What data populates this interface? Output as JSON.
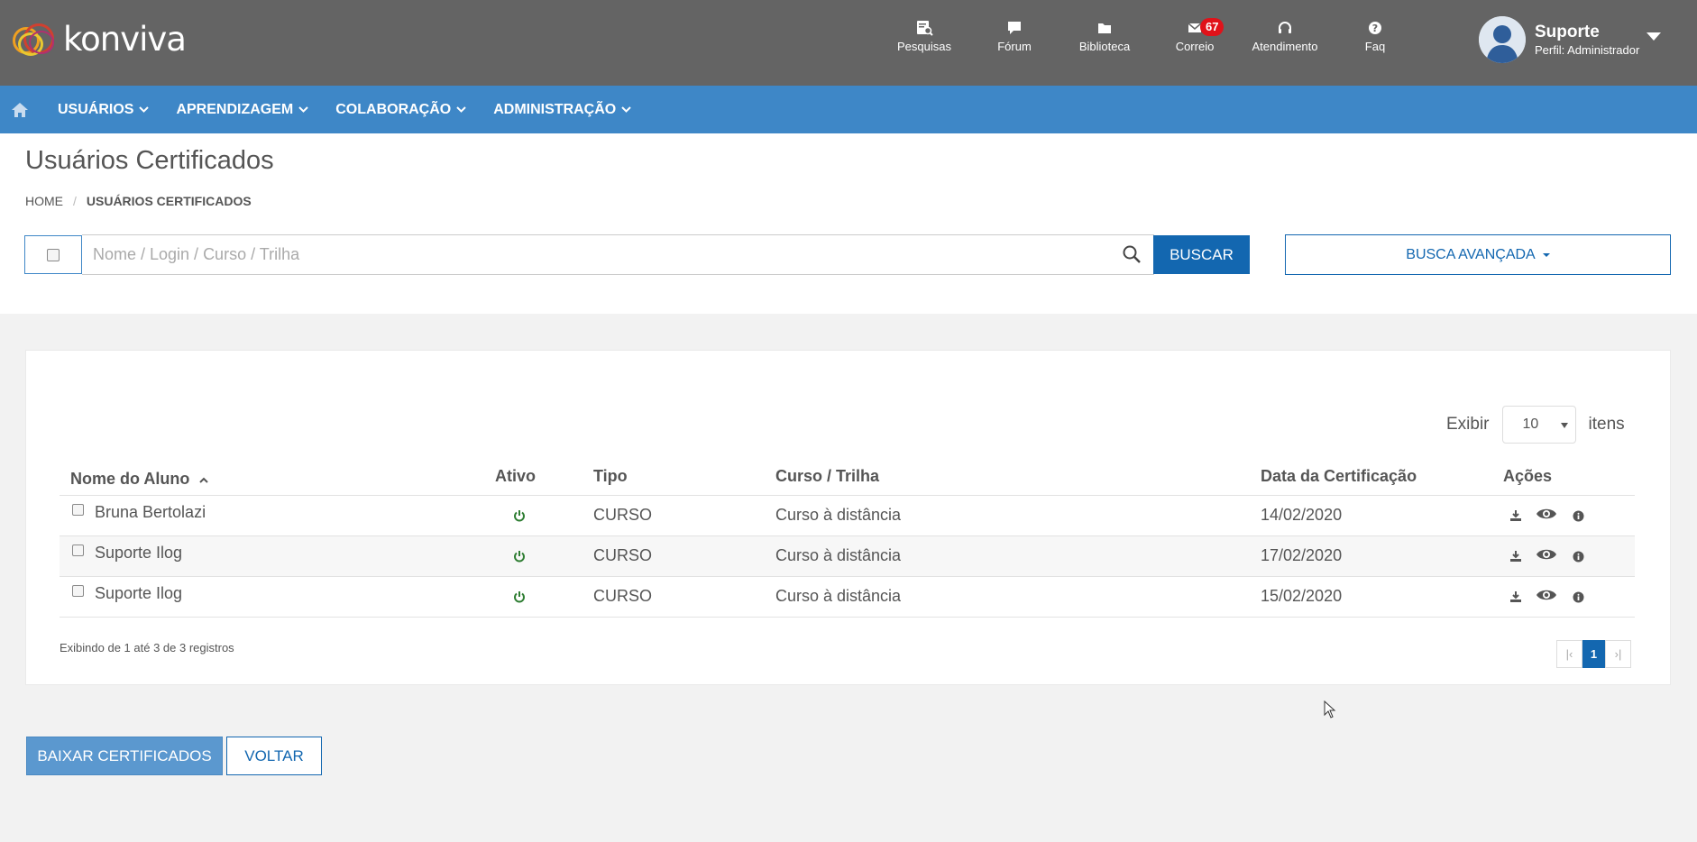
{
  "brand": {
    "name": "konviva"
  },
  "topnav": [
    {
      "label": "Pesquisas",
      "icon": "survey-icon"
    },
    {
      "label": "Fórum",
      "icon": "chat-bubble-icon"
    },
    {
      "label": "Biblioteca",
      "icon": "folder-icon"
    },
    {
      "label": "Correio",
      "icon": "envelope-icon",
      "badge": "67"
    },
    {
      "label": "Atendimento",
      "icon": "headset-icon"
    },
    {
      "label": "Faq",
      "icon": "question-icon"
    }
  ],
  "user": {
    "name": "Suporte",
    "role": "Perfil: Administrador"
  },
  "menu": [
    {
      "label": "USUÁRIOS"
    },
    {
      "label": "APRENDIZAGEM"
    },
    {
      "label": "COLABORAÇÃO"
    },
    {
      "label": "ADMINISTRAÇÃO"
    }
  ],
  "page": {
    "title": "Usuários Certificados",
    "breadcrumb": {
      "home": "HOME",
      "separator": "/",
      "current": "USUÁRIOS CERTIFICADOS"
    }
  },
  "search": {
    "placeholder": "Nome / Login / Curso / Trilha",
    "value": "",
    "button": "BUSCAR",
    "advanced": "BUSCA AVANÇADA"
  },
  "pagesize": {
    "label_before": "Exibir",
    "value": "10",
    "label_after": "itens"
  },
  "table": {
    "columns": {
      "name": "Nome do Aluno",
      "active": "Ativo",
      "type": "Tipo",
      "course": "Curso / Trilha",
      "date": "Data da Certificação",
      "actions": "Ações"
    },
    "rows": [
      {
        "name": "Bruna Bertolazi",
        "type": "CURSO",
        "course": "Curso à distância",
        "date": "14/02/2020"
      },
      {
        "name": "Suporte Ilog",
        "type": "CURSO",
        "course": "Curso à distância",
        "date": "17/02/2020"
      },
      {
        "name": "Suporte Ilog",
        "type": "CURSO",
        "course": "Curso à distância",
        "date": "15/02/2020"
      }
    ],
    "info": "Exibindo de 1 até 3 de 3 registros",
    "pagination": {
      "first": "|‹",
      "current": "1",
      "last": "›|"
    }
  },
  "footer_buttons": {
    "download": "BAIXAR CERTIFICADOS",
    "back": "VOLTAR"
  },
  "colors": {
    "topbar": "#646464",
    "menu": "#3e87c7",
    "primary": "#1367b0",
    "badge": "#e0121a",
    "active_power": "#2e7d32"
  }
}
